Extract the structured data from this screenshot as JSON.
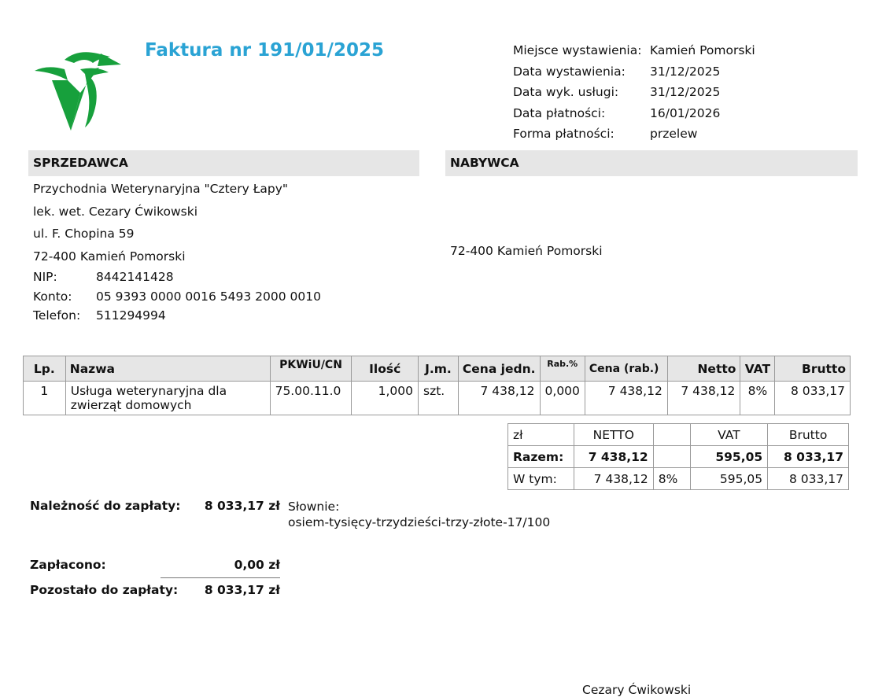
{
  "header": {
    "title": "Faktura nr 191/01/2025"
  },
  "meta": [
    {
      "label": "Miejsce wystawienia:",
      "value": "Kamień Pomorski"
    },
    {
      "label": "Data wystawienia:",
      "value": "31/12/2025"
    },
    {
      "label": "Data wyk. usługi:",
      "value": "31/12/2025"
    },
    {
      "label": "Data płatności:",
      "value": "16/01/2026"
    },
    {
      "label": "Forma płatności:",
      "value": "przelew"
    }
  ],
  "seller": {
    "heading": "SPRZEDAWCA",
    "name": "Przychodnia Weterynaryjna \"Cztery Łapy\"",
    "person": "lek. wet. Cezary Ćwikowski",
    "street": "ul. F. Chopina 59",
    "city": "72-400 Kamień Pomorski",
    "ids": [
      {
        "label": "NIP:",
        "value": "8442141428"
      },
      {
        "label": "Konto:",
        "value": "05 9393 0000 0016 5493 2000 0010"
      },
      {
        "label": "Telefon:",
        "value": "511294994"
      }
    ]
  },
  "buyer": {
    "heading": "NABYWCA",
    "city": "72-400 Kamień Pomorski"
  },
  "items_table": {
    "headers": [
      "Lp.",
      "Nazwa",
      "PKWiU/CN",
      "Ilość",
      "J.m.",
      "Cena jedn.",
      "Rab.%",
      "Cena (rab.)",
      "Netto",
      "VAT",
      "Brutto"
    ],
    "rows": [
      [
        "1",
        "Usługa weterynaryjna dla zwierząt domowych",
        "75.00.11.0",
        "1,000",
        "szt.",
        "7 438,12",
        "0,000",
        "7 438,12",
        "7 438,12",
        "8%",
        "8 033,17"
      ]
    ]
  },
  "summary": {
    "header": [
      "zł",
      "NETTO",
      "",
      "VAT",
      "Brutto"
    ],
    "total": [
      "Razem:",
      "7 438,12",
      "",
      "595,05",
      "8 033,17"
    ],
    "breakdown": [
      "W tym:",
      "7 438,12",
      "8%",
      "595,05",
      "8 033,17"
    ]
  },
  "payment": {
    "due_label": "Należność do zapłaty:",
    "due_amount": "8 033,17 zł",
    "words_label": "Słownie:",
    "words_value": "osiem-tysięcy-trzydzieści-trzy-złote-17/100",
    "paid_label": "Zapłacono:",
    "paid_amount": "0,00 zł",
    "rest_label": "Pozostało do zapłaty:",
    "rest_amount": "8 033,17 zł"
  },
  "signature": "Cezary Ćwikowski",
  "colors": {
    "title": "#2aa3d4",
    "logo": "#17a03c",
    "section_bg": "#e6e6e6"
  }
}
